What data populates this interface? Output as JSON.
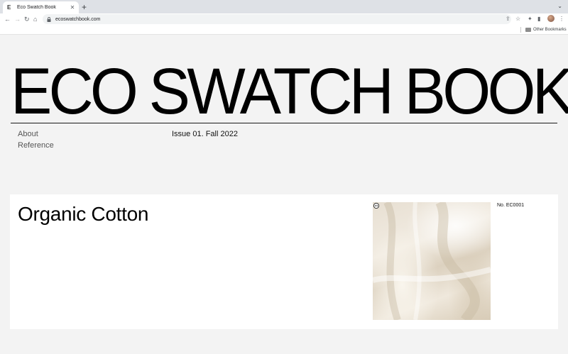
{
  "browser": {
    "tab_title": "Eco Swatch Book",
    "tab_favicon": "E",
    "url": "ecoswatchbook.com",
    "bookmarks_label": "Other Bookmarks"
  },
  "site": {
    "title": "ECO SWATCH BOOK",
    "nav": [
      "About",
      "Reference"
    ],
    "issue": "Issue 01. Fall 2022"
  },
  "entry": {
    "title": "Organic Cotton",
    "number": "No. EC0001",
    "image_alt": "organic cotton fabric swatch"
  },
  "colors": {
    "page_bg": "#f3f3f3",
    "card_bg": "#ffffff",
    "text": "#000000",
    "muted": "#555555"
  }
}
